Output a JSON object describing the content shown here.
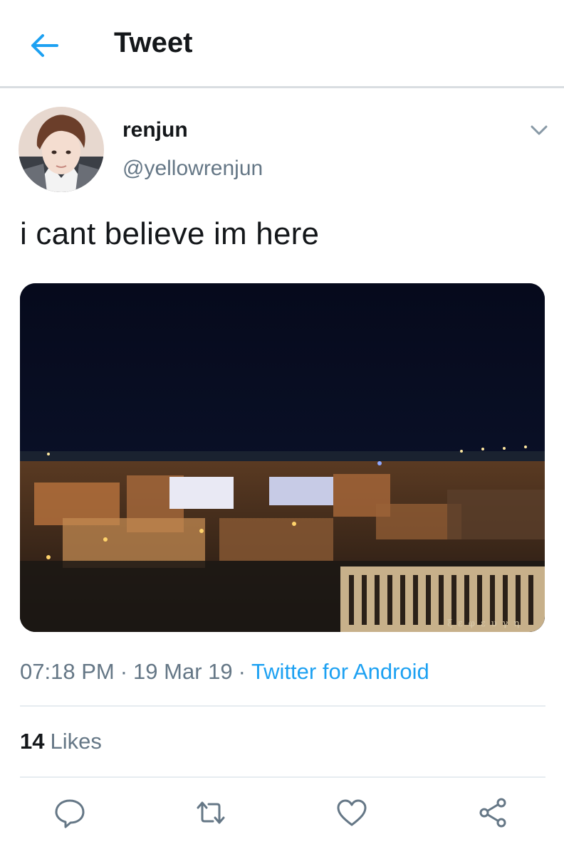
{
  "header": {
    "title": "Tweet",
    "back_icon": "arrow-left-icon",
    "accent": "#1da1f2"
  },
  "tweet": {
    "display_name": "renjun",
    "handle": "@yellowrenjun",
    "text": "i cant believe im here",
    "image_caption": "ξεφευγη",
    "time": "07:18 PM",
    "date": "19 Mar 19",
    "client": "Twitter for Android",
    "likes_count": "14",
    "likes_label": "Likes"
  },
  "actions": [
    {
      "name": "reply",
      "icon": "comment-bubble-icon"
    },
    {
      "name": "retweet",
      "icon": "retweet-arrows-icon"
    },
    {
      "name": "like",
      "icon": "heart-icon"
    },
    {
      "name": "share",
      "icon": "share-nodes-icon"
    }
  ]
}
